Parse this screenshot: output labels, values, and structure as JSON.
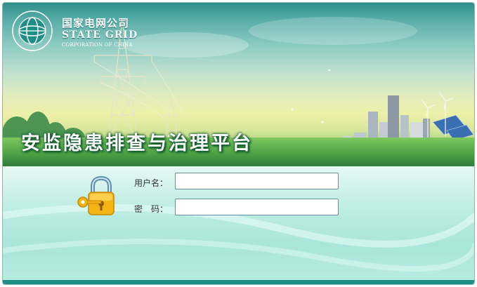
{
  "brand": {
    "name_cn": "国家电网公司",
    "name_en": "STATE GRID",
    "name_sub": "CORPORATION OF CHINA",
    "seal_text": "国家电网公司 STATE GRID CORPORATION OF CHINA"
  },
  "banner": {
    "title": "安监隐患排查与治理平台"
  },
  "login": {
    "username_label": "用户名：",
    "username_value": "",
    "password_label": "密　码：",
    "password_value": ""
  },
  "colors": {
    "teal_dark": "#1f8f86",
    "panel_light": "#c6f0e6",
    "title_shadow": "#0d5a2d"
  },
  "icons": {
    "lock": "lock-key-icon",
    "logo": "state-grid-logo"
  }
}
